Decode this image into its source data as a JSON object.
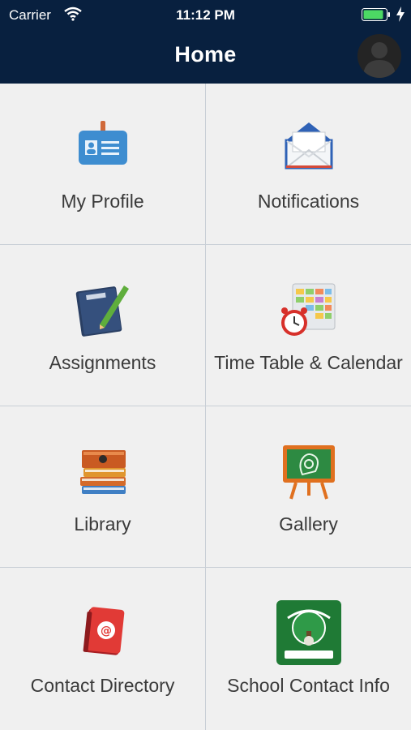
{
  "status_bar": {
    "carrier": "Carrier",
    "time": "11:12 PM"
  },
  "header": {
    "title": "Home"
  },
  "tiles": [
    {
      "label": "My Profile",
      "icon": "id-card-icon"
    },
    {
      "label": "Notifications",
      "icon": "envelope-icon"
    },
    {
      "label": "Assignments",
      "icon": "notebook-pencil-icon"
    },
    {
      "label": "Time Table & Calendar",
      "icon": "calendar-clock-icon"
    },
    {
      "label": "Library",
      "icon": "book-stack-icon"
    },
    {
      "label": "Gallery",
      "icon": "chalkboard-icon"
    },
    {
      "label": "Contact Directory",
      "icon": "address-book-icon"
    },
    {
      "label": "School Contact Info",
      "icon": "school-logo-icon"
    }
  ],
  "colors": {
    "header": "#08203f",
    "background": "#f0f0f0",
    "divider": "#c9cfd6"
  }
}
